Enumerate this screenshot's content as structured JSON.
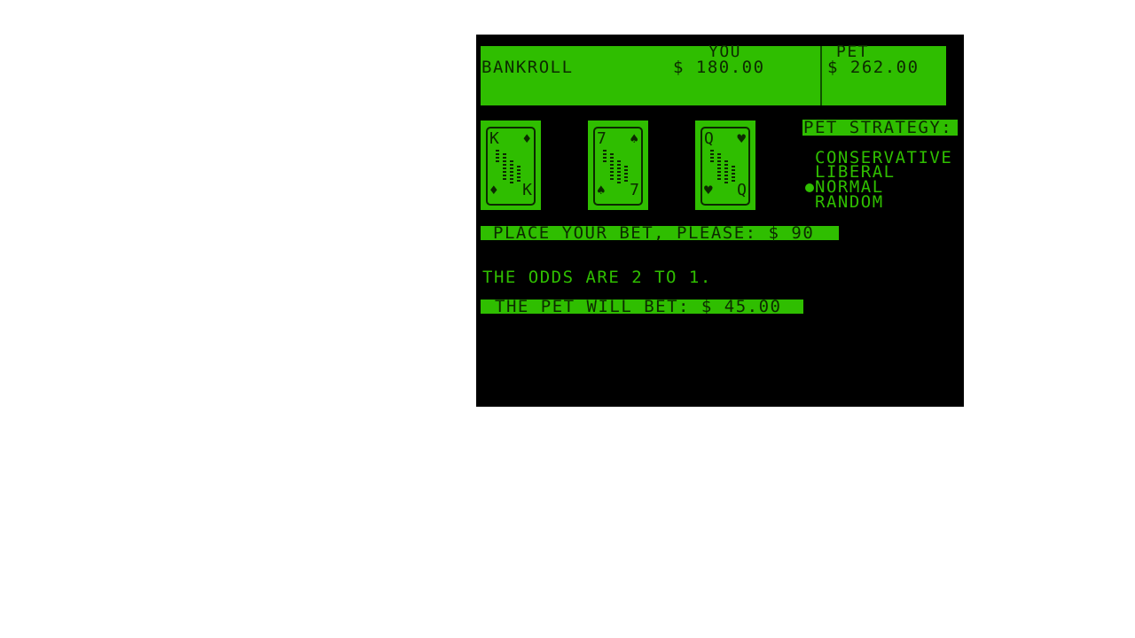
{
  "bankroll": {
    "label": "BANKROLL",
    "you_header": "YOU",
    "you_amount": "$ 180.00",
    "pet_header": "PET",
    "pet_amount": "$ 262.00"
  },
  "cards": [
    {
      "rank": "K",
      "suit": "♦",
      "suit_name": "diamond-icon"
    },
    {
      "rank": "7",
      "suit": "♠",
      "suit_name": "spade-icon"
    },
    {
      "rank": "Q",
      "suit": "♥",
      "suit_name": "heart-icon"
    }
  ],
  "strategy": {
    "title": "PET STRATEGY:",
    "options": [
      "CONSERVATIVE",
      "LIBERAL",
      "NORMAL",
      "RANDOM"
    ],
    "selected": "NORMAL"
  },
  "prompt": "PLACE YOUR BET, PLEASE: $ 90",
  "odds_text": "THE ODDS ARE 2 TO 1.",
  "pet_bet_text": "THE PET WILL BET: $ 45.00",
  "colors": {
    "screen_bg": "#000000",
    "phosphor_green": "#2fbe00",
    "dark_ink": "#0c2a00",
    "page_bg": "#ffffff"
  }
}
